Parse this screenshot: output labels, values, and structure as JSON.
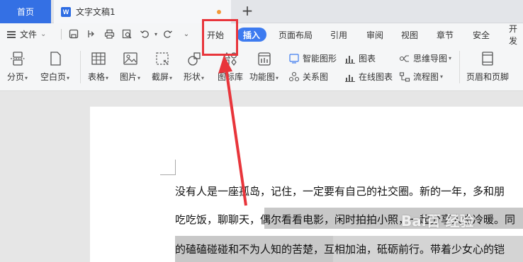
{
  "tabs": {
    "home_label": "首页",
    "doc_title": "文字文稿1",
    "doc_icon_letter": "W",
    "unsaved_color": "#f29a3a",
    "add_label": "+"
  },
  "menu": {
    "file_label": "文件",
    "items": [
      "开始",
      "插入",
      "页面布局",
      "引用",
      "审阅",
      "视图",
      "章节",
      "安全",
      "开发"
    ],
    "active_item": "插入",
    "highlighted_item": "开始"
  },
  "ribbon": {
    "buttons": [
      {
        "label": "分页",
        "dropdown": true,
        "icon": "page-break-icon"
      },
      {
        "label": "空白页",
        "dropdown": true,
        "icon": "blank-page-icon"
      },
      {
        "label": "表格",
        "dropdown": true,
        "icon": "table-icon"
      },
      {
        "label": "图片",
        "dropdown": true,
        "icon": "picture-icon"
      },
      {
        "label": "截屏",
        "dropdown": true,
        "icon": "screenshot-icon"
      },
      {
        "label": "形状",
        "dropdown": true,
        "icon": "shapes-icon"
      },
      {
        "label": "图标库",
        "dropdown": false,
        "icon": "icon-library-icon"
      },
      {
        "label": "功能图",
        "dropdown": true,
        "icon": "function-chart-icon"
      }
    ],
    "small_buttons": [
      {
        "label": "智能图形",
        "icon": "smart-graphic-icon"
      },
      {
        "label": "关系图",
        "icon": "relation-chart-icon"
      },
      {
        "label": "图表",
        "icon": "chart-icon"
      },
      {
        "label": "在线图表",
        "icon": "online-chart-icon"
      },
      {
        "label": "思维导图",
        "icon": "mind-map-icon",
        "dropdown": true
      },
      {
        "label": "流程图",
        "icon": "flowchart-icon",
        "dropdown": true
      }
    ],
    "header_footer_label": "页眉和页脚"
  },
  "document": {
    "lines": [
      "没有人是一座孤岛，记住，一定要有自己的社交圈。新的一年，多和朋",
      "吃吃饭，聊聊天，偶尔看看电影，闲时拍拍小照，一起分享人生冷暖。同",
      "的磕磕碰碰和不为人知的苦楚，互相加油，砥砺前行。带着少女心的铠"
    ]
  },
  "annotation": {
    "box_color": "#e8353b",
    "watermark_text": "Bai百 经验"
  }
}
